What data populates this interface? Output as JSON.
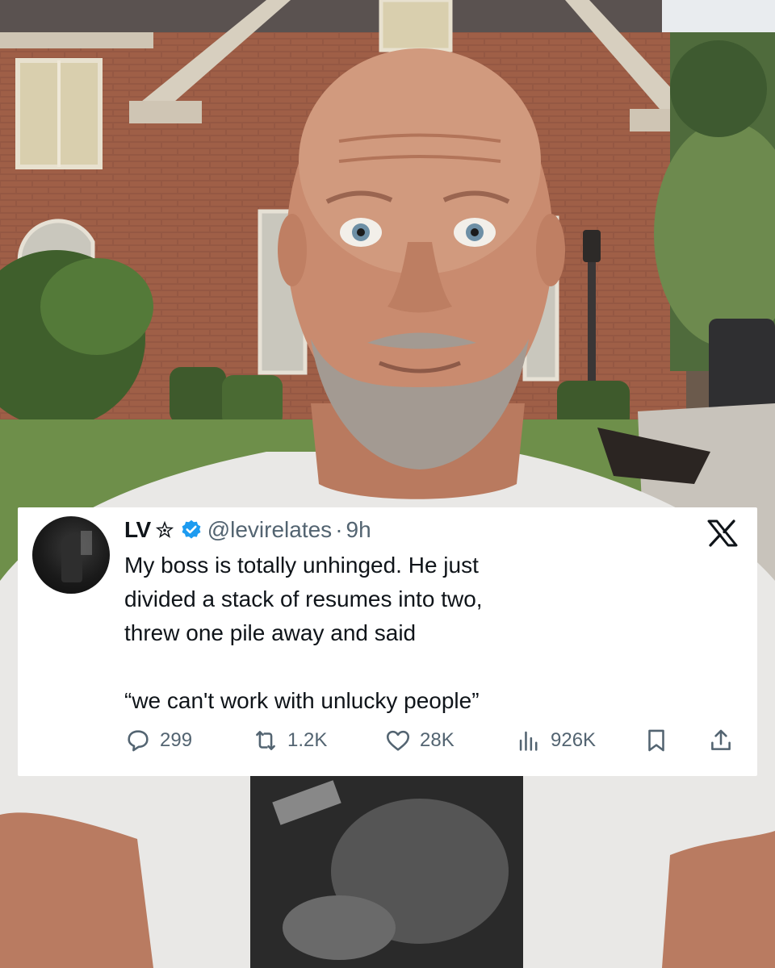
{
  "tweet": {
    "display_name": "LV",
    "handle": "@levirelates",
    "separator": "·",
    "time": "9h",
    "lines": [
      "My boss is totally unhinged. He just",
      "divided a stack of resumes into two,",
      "threw one pile away and said"
    ],
    "quote": "“we can't work with unlucky people”",
    "replies": "299",
    "reposts": "1.2K",
    "likes": "28K",
    "views": "926K"
  },
  "colors": {
    "verified": "#1d9bf0",
    "text": "#0f1419",
    "muted": "#536471"
  },
  "icons": [
    "star-icon",
    "verified-badge-icon",
    "x-logo-icon",
    "reply-icon",
    "repost-icon",
    "like-icon",
    "views-icon",
    "bookmark-icon",
    "share-icon"
  ]
}
